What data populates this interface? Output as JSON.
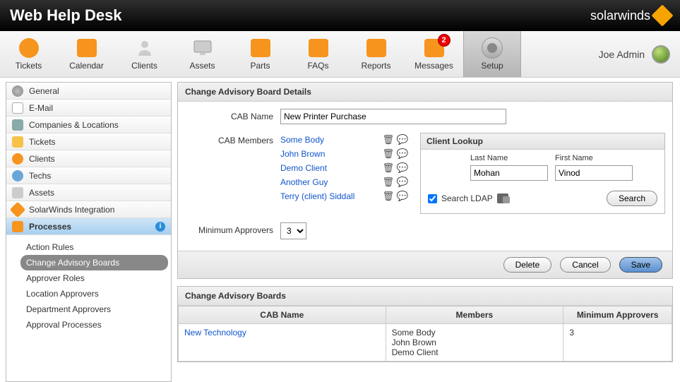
{
  "app_title": "Web Help Desk",
  "brand": "solarwinds",
  "user_name": "Joe Admin",
  "tabs": {
    "tickets": "Tickets",
    "calendar": "Calendar",
    "clients": "Clients",
    "assets": "Assets",
    "parts": "Parts",
    "faqs": "FAQs",
    "reports": "Reports",
    "messages": "Messages",
    "messages_badge": "2",
    "setup": "Setup"
  },
  "sidebar": {
    "items": {
      "general": "General",
      "email": "E-Mail",
      "companies": "Companies & Locations",
      "tickets": "Tickets",
      "clients": "Clients",
      "techs": "Techs",
      "assets": "Assets",
      "sw": "SolarWinds Integration",
      "processes": "Processes"
    },
    "sub": {
      "action_rules": "Action Rules",
      "cab": "Change Advisory Boards",
      "approver_roles": "Approver Roles",
      "location_approvers": "Location Approvers",
      "department_approvers": "Department Approvers",
      "approval_processes": "Approval Processes"
    }
  },
  "details_panel_title": "Change Advisory Board Details",
  "form": {
    "cab_name_label": "CAB Name",
    "cab_name_value": "New Printer Purchase",
    "cab_members_label": "CAB Members",
    "min_approvers_label": "Minimum Approvers",
    "min_approvers_value": "3"
  },
  "members": [
    "Some Body",
    "John Brown",
    "Demo Client",
    "Another Guy",
    "Terry (client) Siddall"
  ],
  "lookup": {
    "title": "Client Lookup",
    "last_name_label": "Last Name",
    "first_name_label": "First Name",
    "last_name_value": "Mohan",
    "first_name_value": "Vinod",
    "ldap_label": "Search LDAP",
    "search_btn": "Search"
  },
  "actions": {
    "delete": "Delete",
    "cancel": "Cancel",
    "save": "Save"
  },
  "list_panel_title": "Change Advisory Boards",
  "list": {
    "cols": {
      "name": "CAB Name",
      "members": "Members",
      "min": "Minimum Approvers"
    },
    "rows": [
      {
        "name": "New Technology",
        "members": [
          "Some Body",
          "John Brown",
          "Demo Client"
        ],
        "min": "3"
      }
    ]
  }
}
